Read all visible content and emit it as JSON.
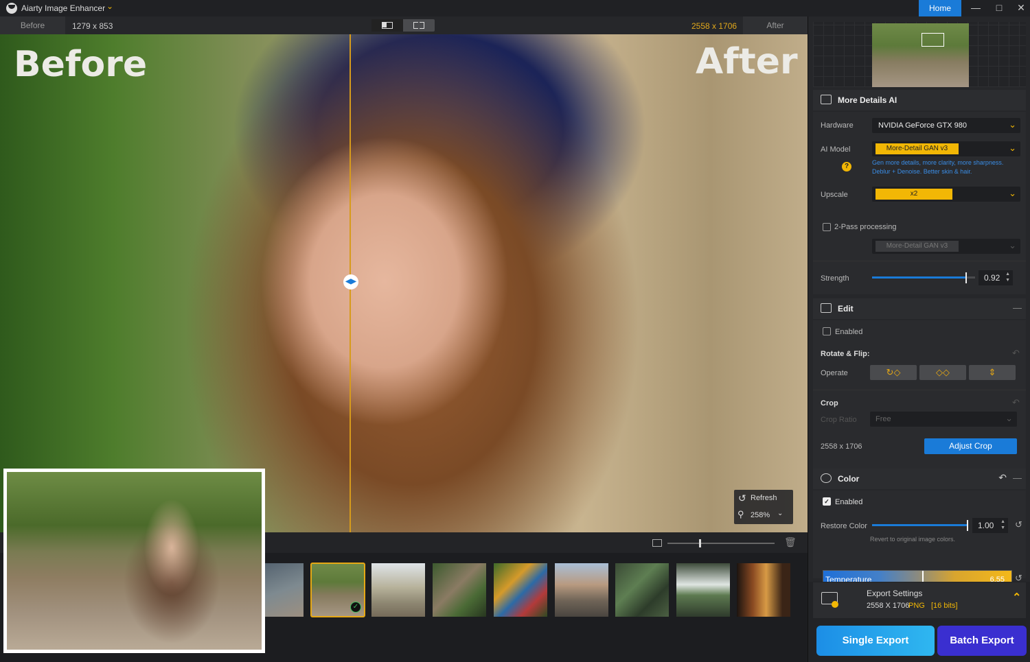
{
  "titlebar": {
    "app_title": "Aiarty Image Enhancer",
    "home_label": "Home"
  },
  "compare": {
    "before_tab": "Before",
    "before_size": "1279 x 853",
    "after_size": "2558 x 1706",
    "after_tab": "After"
  },
  "viewer": {
    "before_overlay": "Before",
    "after_overlay": "After",
    "refresh_label": "Refresh",
    "zoom_label": "258%"
  },
  "panel": {
    "more_details": {
      "title": "More Details AI",
      "hardware_label": "Hardware",
      "hardware_value": "NVIDIA GeForce GTX 980",
      "model_label": "AI Model",
      "model_value": "More-Detail GAN  v3",
      "model_desc_1": "Gen more details, more clarity, more sharpness.",
      "model_desc_2": "Deblur + Denoise. Better skin & hair.",
      "upscale_label": "Upscale",
      "upscale_value": "x2",
      "two_pass_label": "2-Pass processing",
      "two_pass_model": "More-Detail GAN  v3",
      "strength_label": "Strength",
      "strength_value": "0.92",
      "strength_level": 0.92
    },
    "edit": {
      "title": "Edit",
      "enabled_label": "Enabled",
      "rotate_label": "Rotate & Flip:",
      "operate_label": "Operate",
      "crop_label": "Crop",
      "crop_ratio_label": "Crop Ratio",
      "crop_ratio_value": "Free",
      "crop_size": "2558 x 1706",
      "adjust_crop_label": "Adjust Crop"
    },
    "color": {
      "title": "Color",
      "enabled_label": "Enabled",
      "restore_label": "Restore Color",
      "restore_value": "1.00",
      "restore_level": 1.0,
      "restore_desc": "Revert to original image colors.",
      "temperature_label": "Temperature",
      "temperature_value": "6.55"
    },
    "export": {
      "title": "Export Settings",
      "size": "2558 X 1706",
      "format": "PNG",
      "bits": "[16 bits]",
      "single_label": "Single Export",
      "batch_label": "Batch Export"
    }
  },
  "colors": {
    "accent": "#1a7bd8",
    "highlight": "#f2b705",
    "batch": "#3a2fd0"
  }
}
